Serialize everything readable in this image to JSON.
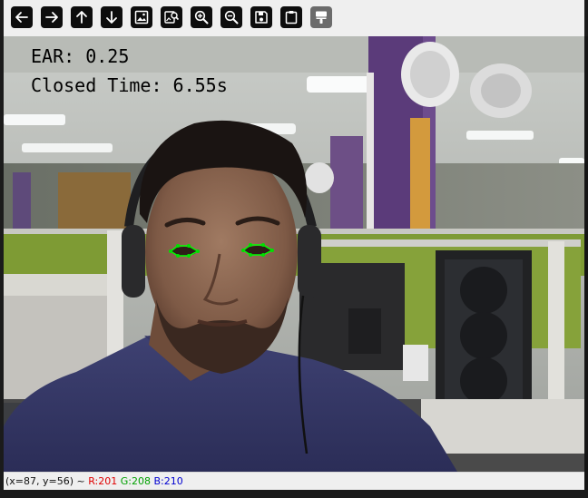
{
  "toolbar": {
    "buttons": [
      {
        "name": "pan-left-button",
        "icon": "arrow-left-icon",
        "enabled": true
      },
      {
        "name": "pan-right-button",
        "icon": "arrow-right-icon",
        "enabled": true
      },
      {
        "name": "pan-up-button",
        "icon": "arrow-up-icon",
        "enabled": true
      },
      {
        "name": "pan-down-button",
        "icon": "arrow-down-icon",
        "enabled": true
      },
      {
        "name": "zoom-fit-button",
        "icon": "image-icon",
        "enabled": true
      },
      {
        "name": "zoom-image-button",
        "icon": "image-search-icon",
        "enabled": true
      },
      {
        "name": "zoom-in-button",
        "icon": "zoom-in-icon",
        "enabled": true
      },
      {
        "name": "zoom-out-button",
        "icon": "zoom-out-icon",
        "enabled": true
      },
      {
        "name": "save-button",
        "icon": "floppy-disk-icon",
        "enabled": true
      },
      {
        "name": "copy-button",
        "icon": "clipboard-icon",
        "enabled": true
      },
      {
        "name": "properties-button",
        "icon": "paint-brush-icon",
        "enabled": false
      }
    ]
  },
  "overlay": {
    "ear_text": "EAR: 0.25",
    "closed_time_text": "Closed Time: 6.55s"
  },
  "status": {
    "coords": "(x=87, y=56) ~",
    "r": "R:201",
    "g": "G:208",
    "b": "B:210"
  },
  "colors": {
    "eye_landmarks": "#00e000",
    "eye_outline": "#00ff00"
  }
}
